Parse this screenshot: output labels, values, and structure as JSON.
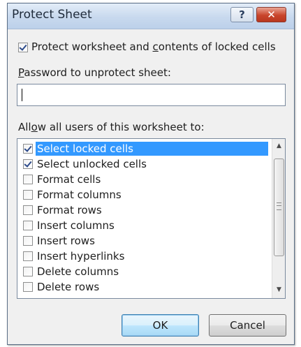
{
  "window": {
    "title": "Protect Sheet",
    "help_label": "?",
    "close_label": "✕"
  },
  "protect_option": {
    "checked": true,
    "label_pre": "Protect worksheet and ",
    "label_u": "c",
    "label_post": "ontents of locked cells"
  },
  "password": {
    "label_u": "P",
    "label_post": "assword to unprotect sheet:",
    "value": ""
  },
  "permissions": {
    "label_pre": "All",
    "label_u": "o",
    "label_post": "w all users of this worksheet to:",
    "items": [
      {
        "label": "Select locked cells",
        "checked": true,
        "selected": true
      },
      {
        "label": "Select unlocked cells",
        "checked": true,
        "selected": false
      },
      {
        "label": "Format cells",
        "checked": false,
        "selected": false
      },
      {
        "label": "Format columns",
        "checked": false,
        "selected": false
      },
      {
        "label": "Format rows",
        "checked": false,
        "selected": false
      },
      {
        "label": "Insert columns",
        "checked": false,
        "selected": false
      },
      {
        "label": "Insert rows",
        "checked": false,
        "selected": false
      },
      {
        "label": "Insert hyperlinks",
        "checked": false,
        "selected": false
      },
      {
        "label": "Delete columns",
        "checked": false,
        "selected": false
      },
      {
        "label": "Delete rows",
        "checked": false,
        "selected": false
      }
    ]
  },
  "buttons": {
    "ok_label": "OK",
    "cancel_label": "Cancel"
  },
  "colors": {
    "selection": "#3399ff",
    "close_button": "#c8452b",
    "title_bar": "#c8d9ee"
  }
}
